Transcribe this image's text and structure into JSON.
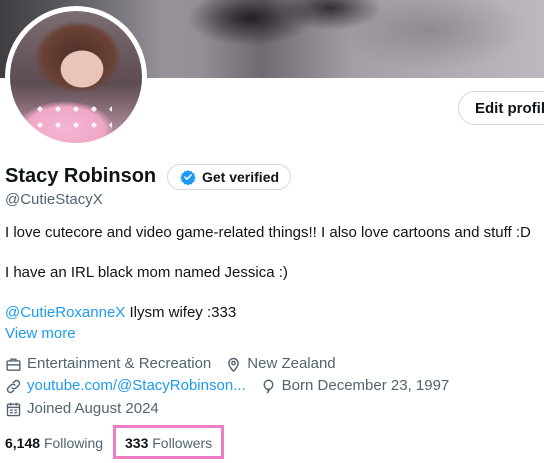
{
  "profile": {
    "name": "Stacy Robinson",
    "handle": "@CutieStacyX",
    "edit_label": "Edit profil",
    "verify_label": "Get verified"
  },
  "bio": {
    "line1": "I love cutecore and video game-related things!! I also love cartoons and stuff :D",
    "line2": "I have an IRL black mom named Jessica :)",
    "mention": "@CutieRoxanneX",
    "line3_rest": " Ilysm wifey :333",
    "view_more": "View more"
  },
  "meta": {
    "category": "Entertainment & Recreation",
    "location": "New Zealand",
    "website": "youtube.com/@StacyRobinson...",
    "born": "Born December 23, 1997",
    "joined": "Joined August 2024"
  },
  "stats": {
    "following_count": "6,148",
    "following_label": "Following",
    "followers_count": "333",
    "followers_label": "Followers"
  },
  "icons": {
    "verified": "verified-badge-icon",
    "category": "briefcase-icon",
    "location": "location-pin-icon",
    "website": "link-icon",
    "born": "balloon-icon",
    "joined": "calendar-icon"
  },
  "colors": {
    "accent": "#1d9bf0",
    "secondary_text": "#536471",
    "highlight_box": "#ef7dc4"
  }
}
